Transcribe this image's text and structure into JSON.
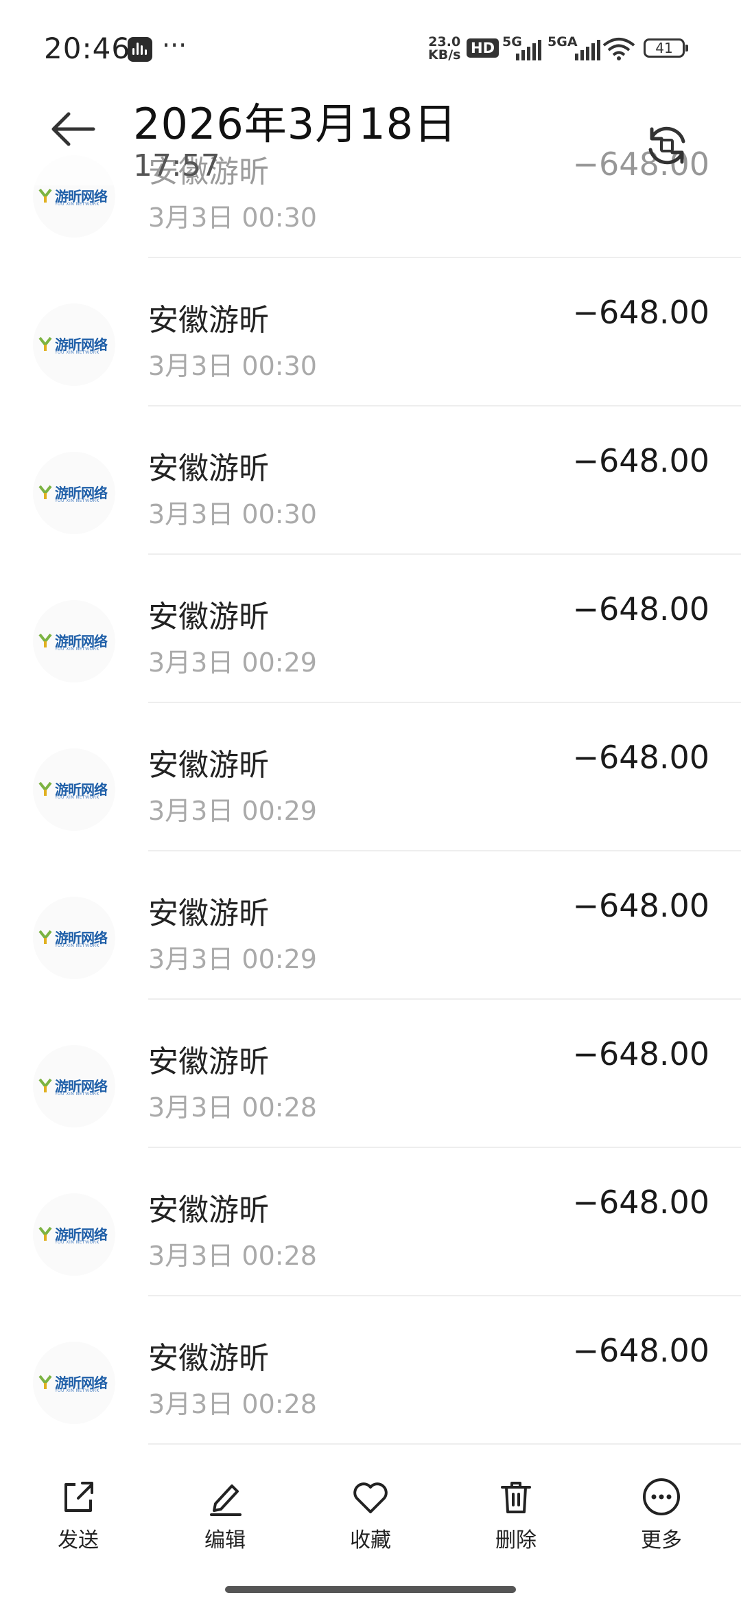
{
  "status_bar": {
    "time": "20:46",
    "overflow": "···",
    "net_speed_value": "23.0",
    "net_speed_unit": "KB/s",
    "hd_badge": "HD",
    "signal1_label": "5G",
    "signal2_label": "5GA",
    "battery_level": "41",
    "icons": [
      "sound-recorder-icon",
      "wifi-icon",
      "battery-icon"
    ]
  },
  "header": {
    "title": "2026年3月18日",
    "subtitle": "17:57",
    "back_icon": "back-arrow-icon",
    "sync_icon": "sync-icon"
  },
  "transactions": [
    {
      "merchant": "安徽游昕",
      "date": "3月3日 00:30",
      "amount": "−648.00"
    },
    {
      "merchant": "安徽游昕",
      "date": "3月3日 00:30",
      "amount": "−648.00"
    },
    {
      "merchant": "安徽游昕",
      "date": "3月3日 00:30",
      "amount": "−648.00"
    },
    {
      "merchant": "安徽游昕",
      "date": "3月3日 00:29",
      "amount": "−648.00"
    },
    {
      "merchant": "安徽游昕",
      "date": "3月3日 00:29",
      "amount": "−648.00"
    },
    {
      "merchant": "安徽游昕",
      "date": "3月3日 00:29",
      "amount": "−648.00"
    },
    {
      "merchant": "安徽游昕",
      "date": "3月3日 00:28",
      "amount": "−648.00"
    },
    {
      "merchant": "安徽游昕",
      "date": "3月3日 00:28",
      "amount": "−648.00"
    },
    {
      "merchant": "安徽游昕",
      "date": "3月3日 00:28",
      "amount": "−648.00"
    }
  ],
  "merchant_logo": {
    "text_cn": "游昕网络",
    "text_en": "YOU XIN NETWORK"
  },
  "toolbar": {
    "send": "发送",
    "edit": "编辑",
    "favorite": "收藏",
    "delete": "删除",
    "more": "更多"
  },
  "colors": {
    "text_primary": "#222222",
    "text_secondary": "#aaaaaa",
    "logo_blue": "#1f5fa8",
    "logo_green": "#7cb342"
  }
}
